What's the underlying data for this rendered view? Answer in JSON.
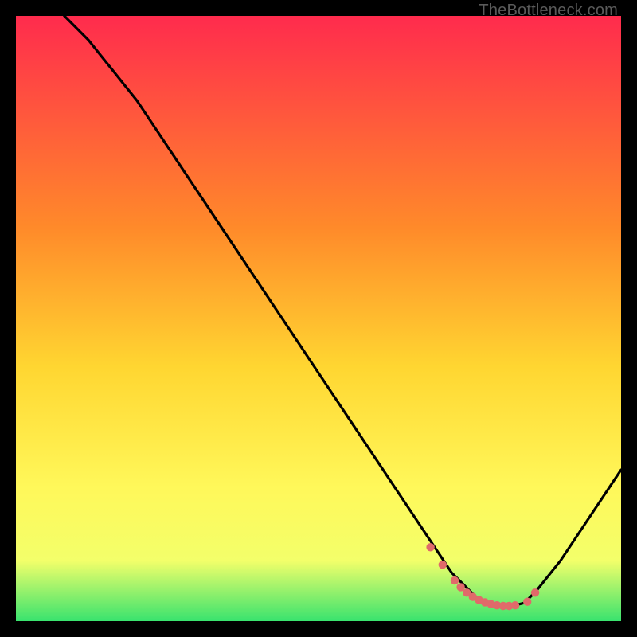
{
  "watermark": "TheBottleneck.com",
  "colors": {
    "gradient_top": "#ff2b4d",
    "gradient_mid1": "#ff8a2a",
    "gradient_mid2": "#ffd631",
    "gradient_mid3": "#fff85a",
    "gradient_mid4": "#f3ff6a",
    "gradient_bottom": "#39e36e",
    "curve": "#000000",
    "dots": "#e06a6a",
    "frame": "#000000"
  },
  "chart_data": {
    "type": "line",
    "title": "",
    "xlabel": "",
    "ylabel": "",
    "xlim": [
      0,
      100
    ],
    "ylim": [
      0,
      100
    ],
    "series": [
      {
        "name": "bottleneck_curve",
        "x": [
          8,
          12,
          16,
          20,
          24,
          28,
          32,
          36,
          40,
          44,
          48,
          52,
          56,
          60,
          64,
          68,
          70,
          72,
          74,
          76,
          78,
          80,
          82,
          84,
          86,
          90,
          94,
          98,
          100
        ],
        "y": [
          100,
          96,
          91,
          86,
          80,
          74,
          68,
          62,
          56,
          50,
          44,
          38,
          32,
          26,
          20,
          14,
          11,
          8,
          6,
          4,
          3,
          2.5,
          2.5,
          3,
          5,
          10,
          16,
          22,
          25
        ]
      }
    ],
    "dots": {
      "name": "highlighted_points",
      "x": [
        68.5,
        70.5,
        72.5,
        73.5,
        74.5,
        75.5,
        76.5,
        77.5,
        78.5,
        79.5,
        80.5,
        81.5,
        82.5,
        84.5,
        85.8
      ],
      "y": [
        12.2,
        9.3,
        6.7,
        5.6,
        4.7,
        4.0,
        3.5,
        3.1,
        2.8,
        2.6,
        2.5,
        2.5,
        2.6,
        3.2,
        4.7
      ]
    }
  }
}
